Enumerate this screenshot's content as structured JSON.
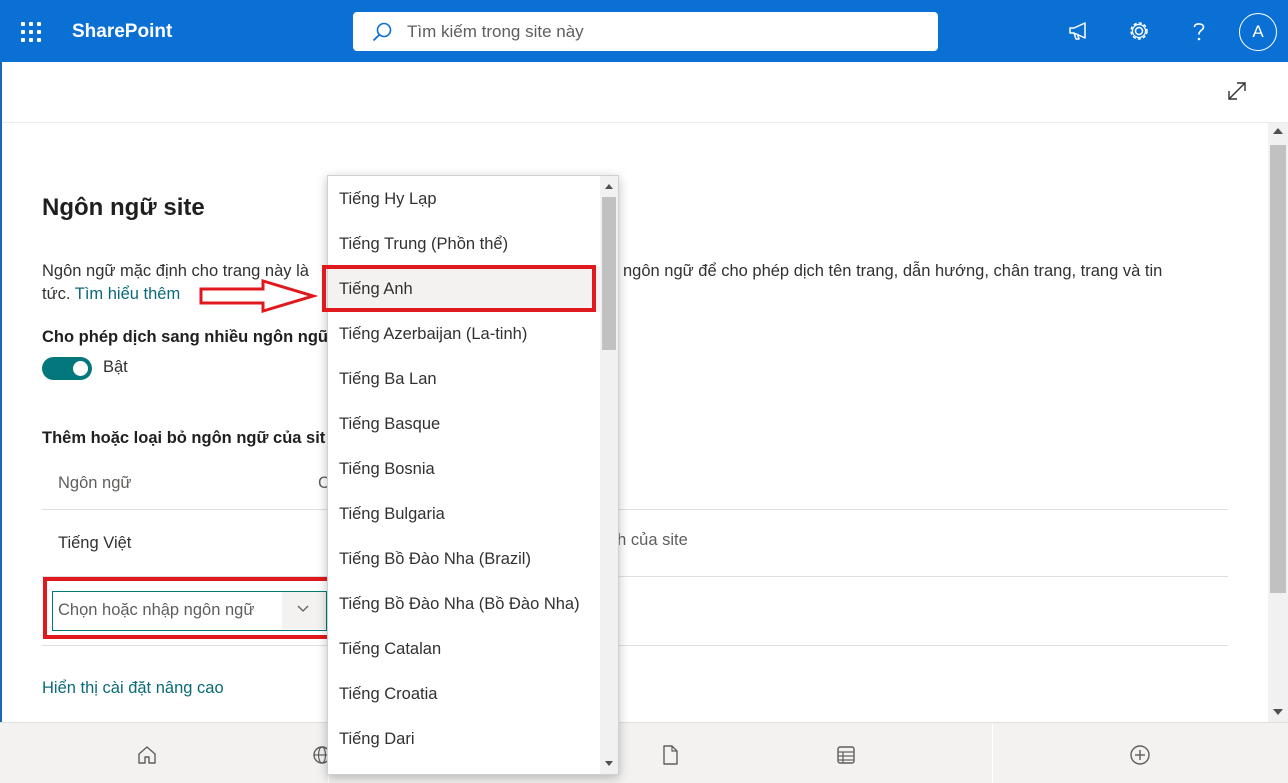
{
  "suitebar": {
    "app_name": "SharePoint",
    "search_placeholder": "Tìm kiếm trong site này",
    "avatar_initial": "A",
    "icons": [
      "app-launcher-icon",
      "search-icon",
      "megaphone-icon",
      "gear-icon",
      "help-icon"
    ]
  },
  "panel": {
    "title": "Ngôn ngữ site",
    "description_line1_start": "Ngôn ngữ mặc định cho trang này là",
    "description_line1_end": "ngôn ngữ để cho phép dịch tên trang, dẫn hướng, chân trang, trang và tin",
    "description_line2": "tức.",
    "learn_more": "Tìm hiểu thêm",
    "toggle_label": "Cho phép dịch sang nhiều ngôn ngữ",
    "toggle_state": "Bật",
    "toggle_on": true,
    "add_remove_label": "Thêm hoặc loại bỏ ngôn ngữ của sit",
    "table": {
      "col_language": "Ngôn ngữ",
      "col_other": "C",
      "rows": [
        {
          "language": "Tiếng Việt",
          "note": "nh của site"
        }
      ]
    },
    "combo_placeholder": "Chọn hoặc nhập ngôn ngữ",
    "advanced_link": "Hiển thị cài đặt nâng cao"
  },
  "dropdown": {
    "options": [
      "Tiếng Hy Lạp",
      "Tiếng Trung (Phồn thể)",
      "Tiếng Anh",
      "Tiếng Azerbaijan (La-tinh)",
      "Tiếng Ba Lan",
      "Tiếng Basque",
      "Tiếng Bosnia",
      "Tiếng Bulgaria",
      "Tiếng Bồ Đào Nha (Brazil)",
      "Tiếng Bồ Đào Nha (Bồ Đào Nha)",
      "Tiếng Catalan",
      "Tiếng Croatia",
      "Tiếng Dari"
    ],
    "highlighted": "Tiếng Anh"
  },
  "colors": {
    "suitebar": "#0a70d4",
    "accent": "#03787c",
    "annotation": "#e0191f"
  }
}
